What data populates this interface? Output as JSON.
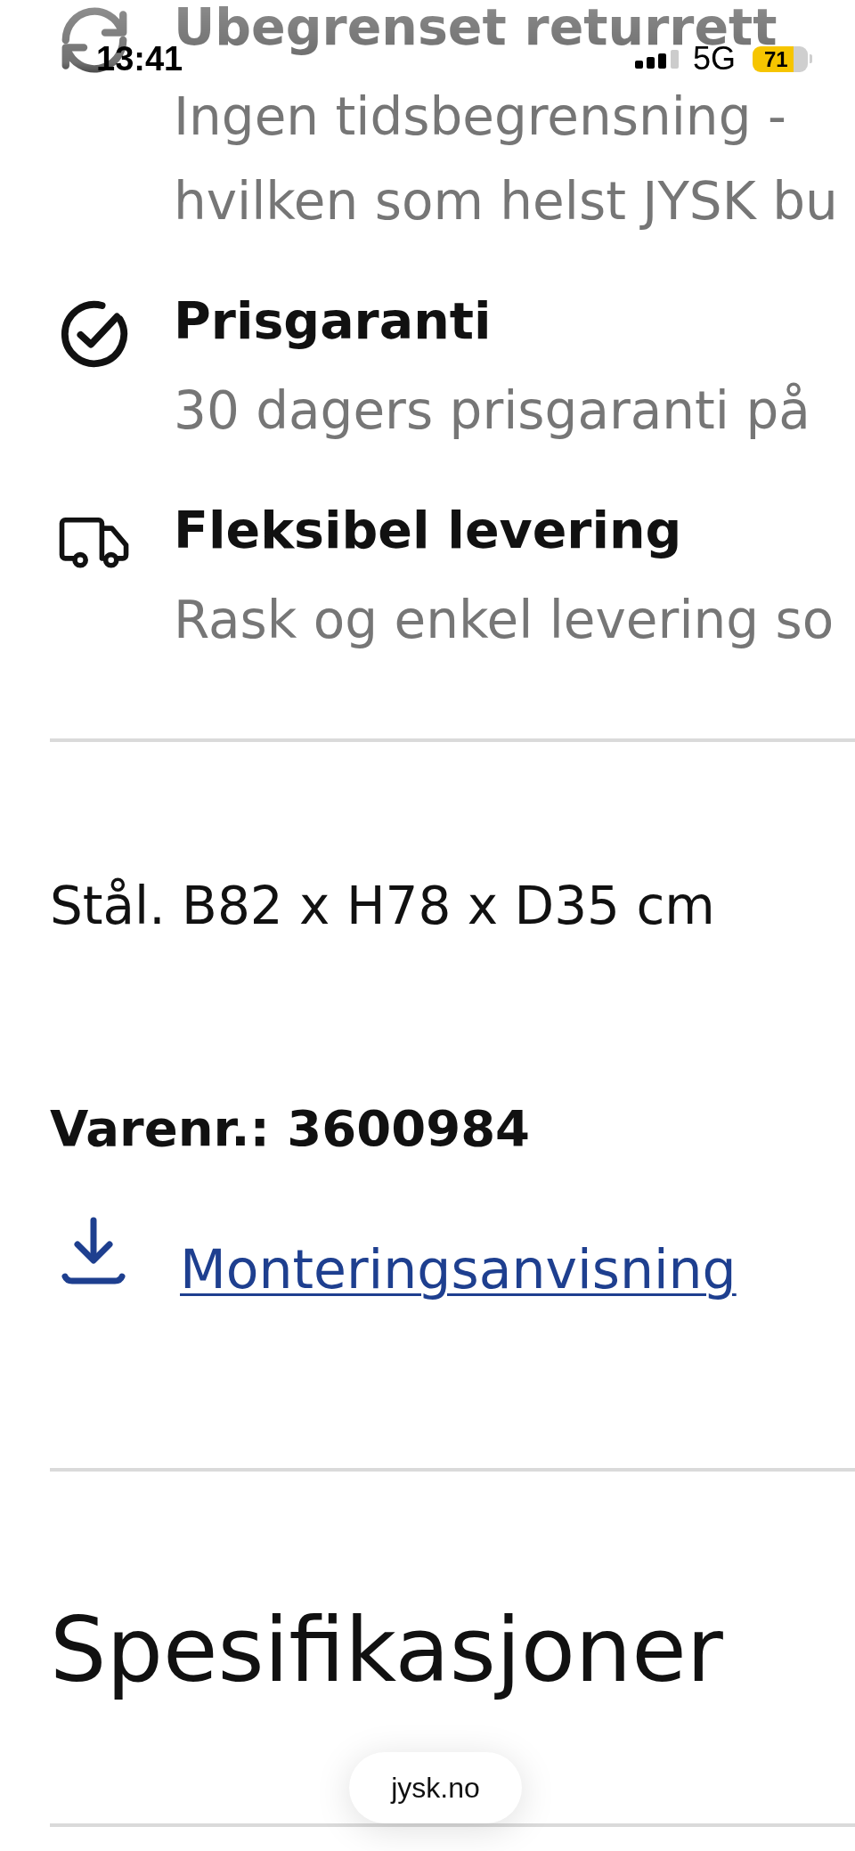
{
  "status_bar": {
    "time": "13:41",
    "network": "5G",
    "battery": "71"
  },
  "benefits": [
    {
      "kind": "returns",
      "title": "Ubegrenset returrett",
      "description": [
        "Ingen tidsbegrensning -",
        "hvilken som helst JYSK bu"
      ]
    },
    {
      "kind": "price_guarantee",
      "title": "Prisgaranti",
      "description": [
        "30 dagers prisgaranti på"
      ]
    },
    {
      "kind": "delivery",
      "title": "Fleksibel levering",
      "description": [
        "Rask og enkel levering so"
      ]
    }
  ],
  "product": {
    "dimensions": "Stål. B82 x H78 x D35 cm",
    "item_number": "Varenr.: 3600984",
    "assembly_link": "Monteringsanvisning"
  },
  "specifications": {
    "heading": "Spesifikasjoner"
  },
  "address_bar": {
    "url": "jysk.no"
  }
}
